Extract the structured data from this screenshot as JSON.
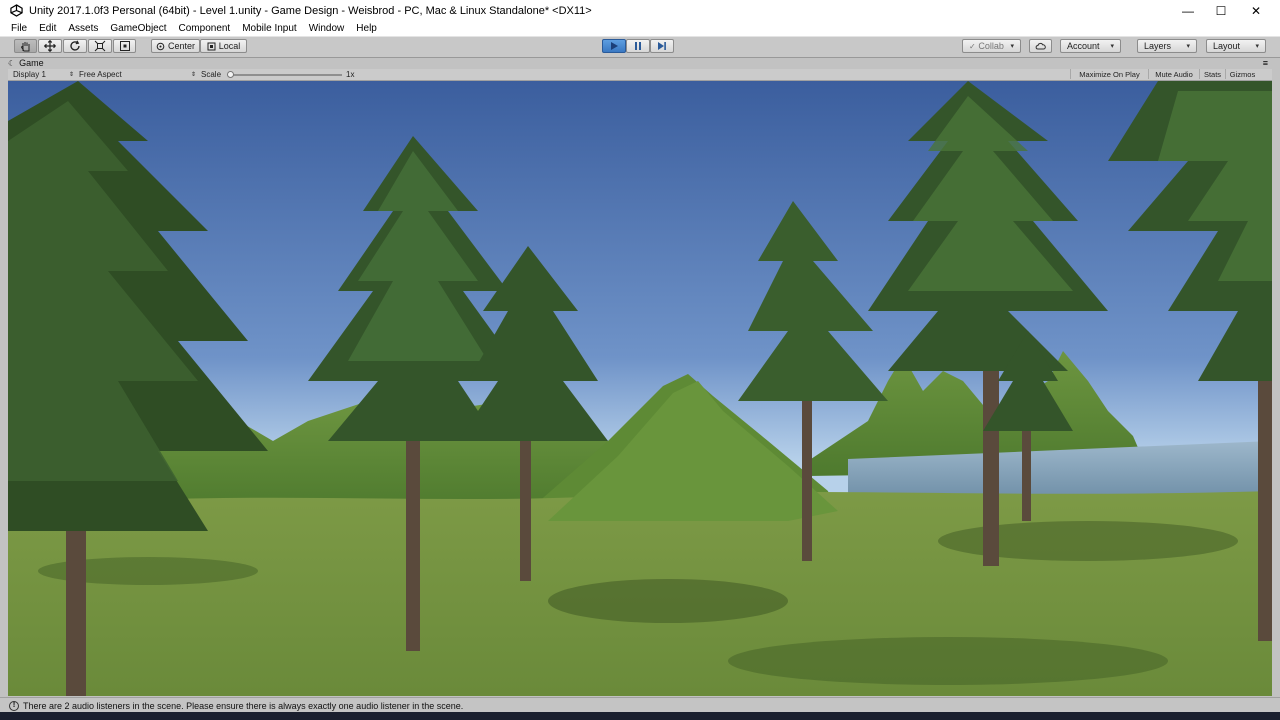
{
  "titlebar": {
    "title": "Unity 2017.1.0f3 Personal (64bit) - Level 1.unity - Game Design - Weisbrod - PC, Mac & Linux Standalone* <DX11>",
    "minimize": "—",
    "maximize": "☐",
    "close": "✕"
  },
  "menu": {
    "items": [
      "File",
      "Edit",
      "Assets",
      "GameObject",
      "Component",
      "Mobile Input",
      "Window",
      "Help"
    ]
  },
  "toolbar": {
    "tools": [
      "hand-tool",
      "move-tool",
      "rotate-tool",
      "scale-tool",
      "rect-tool"
    ],
    "center_label": "Center",
    "local_label": "Local",
    "collab_label": "Collab",
    "account_label": "Account",
    "layers_label": "Layers",
    "layout_label": "Layout",
    "play_active": true
  },
  "game_tab": {
    "label": "Game"
  },
  "game_bar": {
    "display": "Display 1",
    "aspect": "Free Aspect",
    "scale_label": "Scale",
    "scale_value": "1x",
    "maximize_on_play": "Maximize On Play",
    "mute_audio": "Mute Audio",
    "stats": "Stats",
    "gizmos": "Gizmos"
  },
  "status": {
    "message": "There are 2 audio listeners in the scene. Please ensure there is always exactly one audio listener in the scene."
  },
  "colors": {
    "sky_top": "#3d5fa0",
    "sky_bottom": "#a9c7e8",
    "grass": "#6f8f3a",
    "hill": "#5d8a34",
    "water": "#7f9fb8",
    "play_blue": "#3a78c2"
  }
}
